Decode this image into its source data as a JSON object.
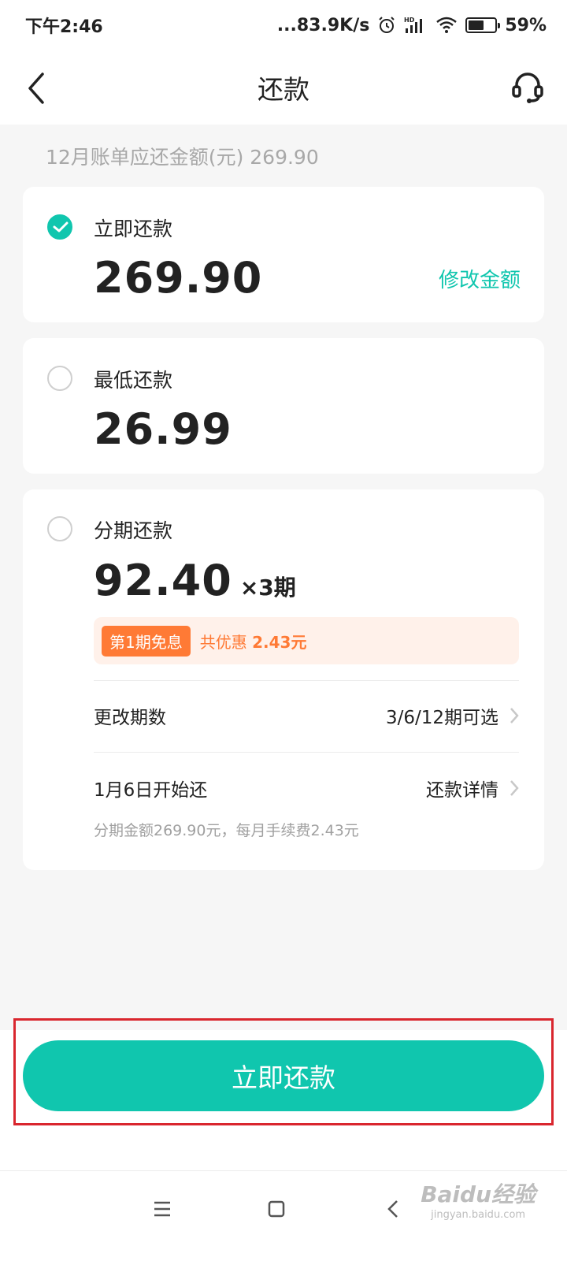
{
  "status_bar": {
    "time": "下午2:46",
    "network_speed": "...83.9K/s",
    "battery_percent": "59%",
    "battery_level": 0.59,
    "icons": [
      "alarm-icon",
      "hd-signal-icon",
      "wifi-icon",
      "battery-icon"
    ]
  },
  "header": {
    "title": "还款",
    "back_icon": "chevron-left-icon",
    "service_icon": "headset-icon"
  },
  "bill_summary": "12月账单应还金额(元) 269.90",
  "options": [
    {
      "label": "立即还款",
      "amount": "269.90",
      "selected": true,
      "edit_label": "修改金额"
    },
    {
      "label": "最低还款",
      "amount": "26.99",
      "selected": false
    },
    {
      "label": "分期还款",
      "amount": "92.40",
      "suffix": "×3期",
      "selected": false,
      "promo_tag": "第1期免息",
      "promo_text": "共优惠 ",
      "promo_value": "2.43元",
      "change_terms": {
        "label": "更改期数",
        "value": "3/6/12期可选"
      },
      "start": {
        "label": "1月6日开始还",
        "value": "还款详情"
      },
      "note": "分期金额269.90元，每月手续费2.43元"
    }
  ],
  "footer": {
    "button_label": "立即还款"
  },
  "colors": {
    "accent": "#10c6ae",
    "promo": "#ff7a35",
    "highlight": "#d9262e"
  },
  "watermark": {
    "main": "Baidu经验",
    "sub": "jingyan.baidu.com"
  }
}
